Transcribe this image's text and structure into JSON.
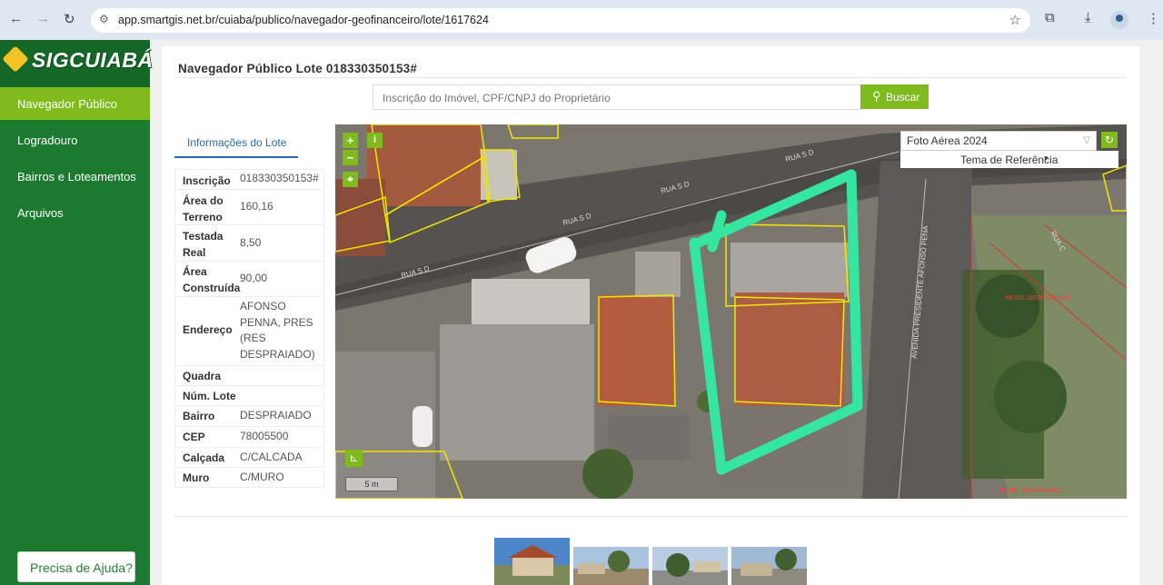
{
  "browser": {
    "url": "app.smartgis.net.br/cuiaba/publico/navegador-geofinanceiro/lote/1617624"
  },
  "sidebar": {
    "logo_text": "SIGCUIABÁ",
    "items": [
      {
        "label": "Navegador Público",
        "active": true
      },
      {
        "label": "Logradouro",
        "active": false
      },
      {
        "label": "Bairros e Loteamentos",
        "active": false
      },
      {
        "label": "Arquivos",
        "active": false
      }
    ],
    "help_label": "Precisa de Ajuda?"
  },
  "main": {
    "title": "Navegador Público Lote 018330350153#",
    "search_placeholder": "Inscrição do Imóvel, CPF/CNPJ do Proprietário",
    "search_button": "Buscar",
    "tab_label": "Informações do Lote",
    "info": [
      {
        "key": "Inscrição",
        "value": "018330350153#"
      },
      {
        "key": "Área do Terreno",
        "value": "160,16"
      },
      {
        "key": "Testada Real",
        "value": "8,50"
      },
      {
        "key": "Área Construída",
        "value": "90,00"
      },
      {
        "key": "Endereço",
        "value": "AFONSO PENNA, PRES (RES DESPRAIADO)"
      },
      {
        "key": "Quadra",
        "value": ""
      },
      {
        "key": "Núm. Lote",
        "value": ""
      },
      {
        "key": "Bairro",
        "value": "DESPRAIADO"
      },
      {
        "key": "CEP",
        "value": "78005500"
      },
      {
        "key": "Calçada",
        "value": "C/CALCADA"
      },
      {
        "key": "Muro",
        "value": "C/MURO"
      }
    ]
  },
  "map": {
    "layer": "Foto Aérea 2024",
    "reference_theme": "Tema de Referência",
    "scale_label": "5 m",
    "street_labels": [
      "RUA S D",
      "RUA S D",
      "RUA S D",
      "RUA S D",
      "AVENIDA PRESIDENTE AFONSO PENA",
      "RUA C"
    ],
    "area_labels": [
      "RESID. DESPRAIADO",
      "RESID. DESPRAIADO"
    ],
    "colors": {
      "parcel_outline": "#f2e600",
      "highlight": "#35e6a0",
      "accent": "#7fbb1d"
    }
  }
}
